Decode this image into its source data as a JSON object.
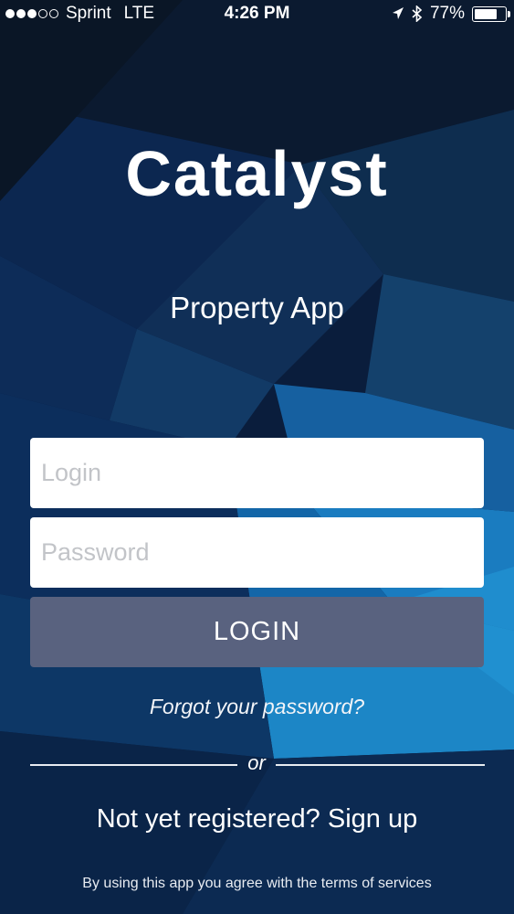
{
  "status_bar": {
    "carrier": "Sprint",
    "network": "LTE",
    "time": "4:26 PM",
    "battery_percent": "77%",
    "battery_level": 0.77,
    "signal_bars_filled": 3,
    "signal_bars_total": 5,
    "icons": [
      "location-arrow-icon",
      "bluetooth-icon",
      "battery-icon"
    ]
  },
  "app": {
    "title": "Catalyst",
    "subtitle": "Property App"
  },
  "form": {
    "login_placeholder": "Login",
    "login_value": "",
    "password_placeholder": "Password",
    "password_value": "",
    "login_button": "LOGIN"
  },
  "links": {
    "forgot_password": "Forgot your password?",
    "or_label": "or",
    "signup": "Not yet registered? Sign up",
    "terms": "By using this app you agree with the terms of services"
  },
  "colors": {
    "login_button_bg": "#59627f",
    "background_dark": "#071a33",
    "background_accent": "#1378b8"
  }
}
